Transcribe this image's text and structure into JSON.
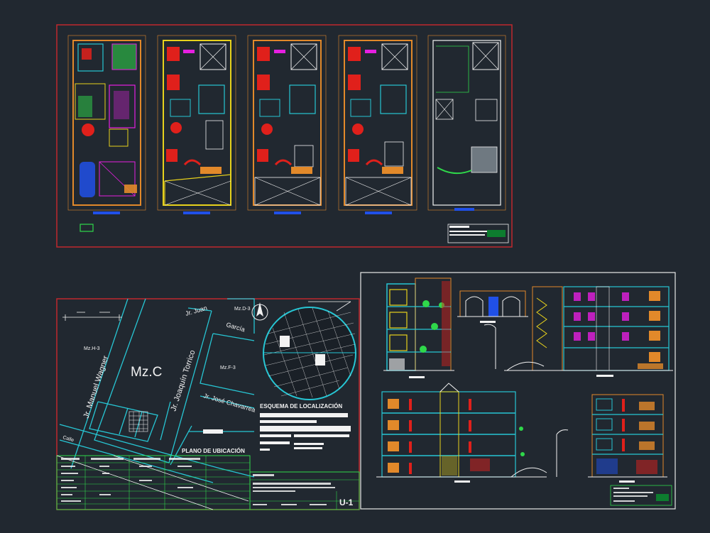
{
  "canvas": {
    "background": "#212830"
  },
  "colors": {
    "sheet_border_red": "#c0282d",
    "sheet_border_white": "#e8e8e8",
    "wall_orange": "#e2892a",
    "wall_yellow": "#e8d21c",
    "cyan": "#27c6d4",
    "magenta": "#e61fe1",
    "red": "#e0201b",
    "green": "#2fd84a",
    "blue": "#2050e8",
    "white": "#f2f2f2",
    "dark_green": "#0d7d2f"
  },
  "sheet_location": {
    "block_label": "Mz.C",
    "streets": {
      "juan_garcia_1": "Jr. Juan",
      "juan_garcia_2": "García",
      "wagner": "Jr. Manuel Wagner",
      "torrico": "Jr. Joaquín Torrico",
      "chavarrea": "Jr. José Chavarrea"
    },
    "lot_labels": {
      "left": "Mz.H-3",
      "right": "Mz.F-3",
      "top_right": "Mz.D-3"
    },
    "corner_label": "Calle",
    "plan_title": "PLANO DE UBICACIÓN",
    "locality_title": "ESQUEMA DE LOCALIZACIÓN",
    "sheet_code": "U-1"
  }
}
